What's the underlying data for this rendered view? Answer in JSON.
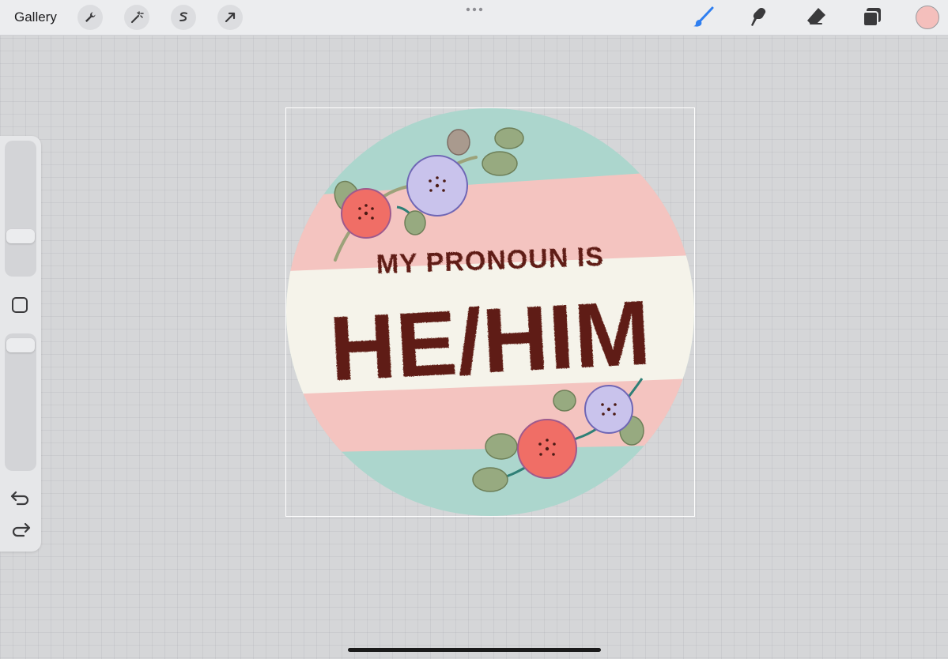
{
  "topbar": {
    "gallery_label": "Gallery",
    "left_tools": [
      "wrench-icon",
      "magic-wand-icon",
      "selection-icon",
      "transform-arrow-icon"
    ],
    "right_tools": [
      "brush-icon",
      "smudge-icon",
      "eraser-icon",
      "layers-icon"
    ],
    "active_tool": "brush-icon",
    "accent_color": "#2f7ff0",
    "current_color": "#f4bfbc"
  },
  "sidebar": {
    "icons": [
      "modify-square-icon",
      "undo-icon",
      "redo-icon"
    ]
  },
  "artwork": {
    "line1": "MY PRONOUN IS",
    "line2": "HE/HIM",
    "stripe_colors": [
      "#acd6cd",
      "#f4c4c0",
      "#f5f3ea",
      "#f4c4c0",
      "#acd6cd"
    ],
    "text_color": "#5e1d13"
  }
}
